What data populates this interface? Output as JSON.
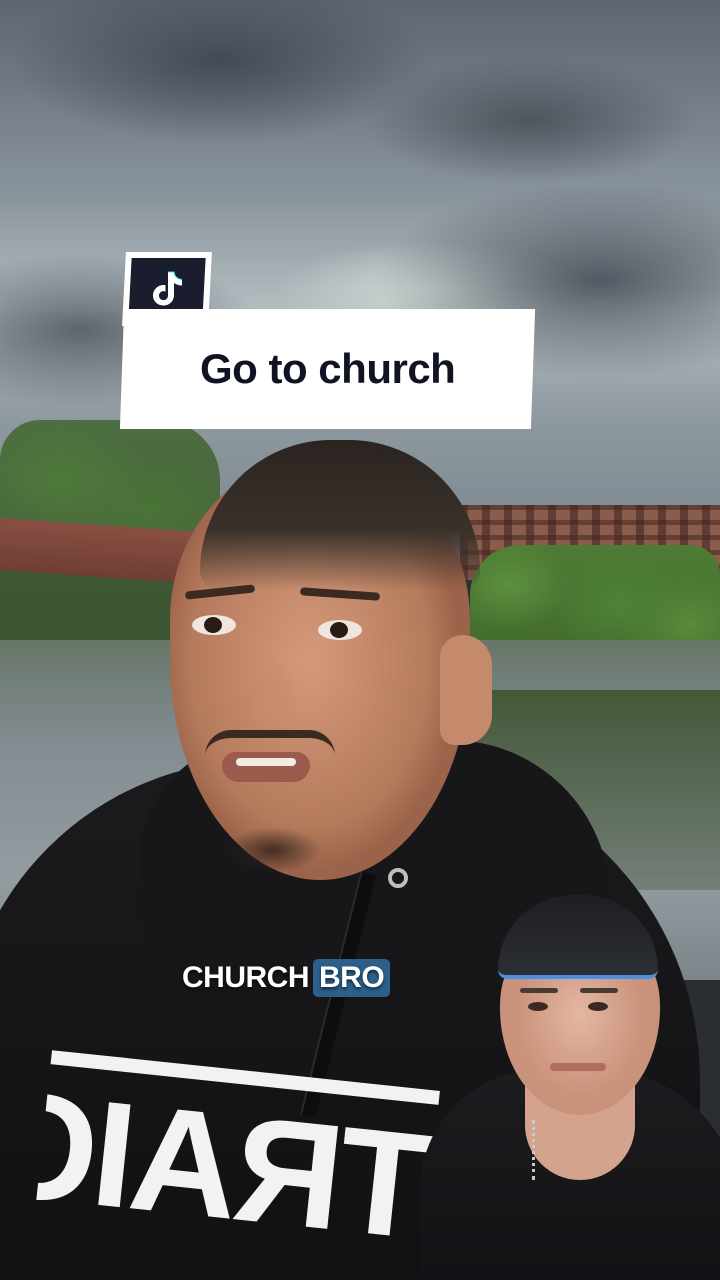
{
  "overlay": {
    "title": "Go to church",
    "app_icon": "tiktok-icon"
  },
  "caption": {
    "word_1": "CHURCH",
    "word_2": "BRO",
    "highlight_color": "#2c5f8a"
  },
  "shirt": {
    "print_text": "TRAIGHT"
  },
  "colors": {
    "title_card_bg": "#ffffff",
    "title_text": "#0f1322",
    "badge_bg": "#1a1d2e"
  }
}
